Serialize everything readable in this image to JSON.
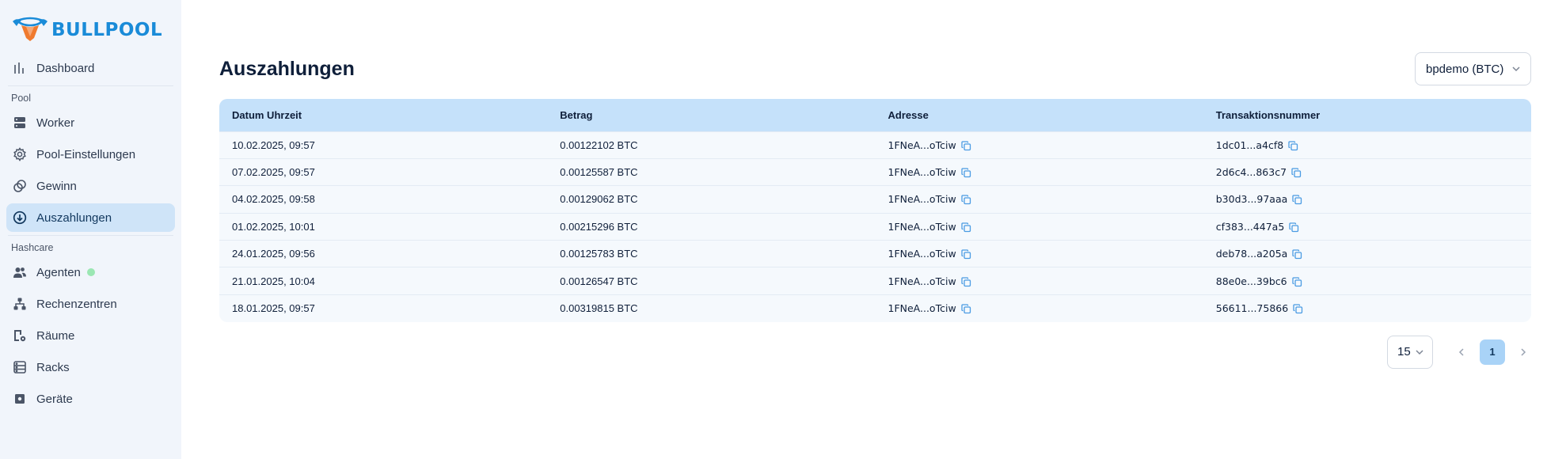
{
  "brand": {
    "name": "BULLPOOL"
  },
  "sidebar": {
    "top_items": [
      {
        "label": "Dashboard",
        "icon": "bar-chart-icon"
      }
    ],
    "sections": [
      {
        "label": "Pool",
        "items": [
          {
            "label": "Worker",
            "icon": "server-icon"
          },
          {
            "label": "Pool-Einstellungen",
            "icon": "gear-icon"
          },
          {
            "label": "Gewinn",
            "icon": "coins-icon"
          },
          {
            "label": "Auszahlungen",
            "icon": "download-circle-icon",
            "active": true
          }
        ]
      },
      {
        "label": "Hashcare",
        "items": [
          {
            "label": "Agenten",
            "icon": "users-icon",
            "status": "online"
          },
          {
            "label": "Rechenzentren",
            "icon": "hierarchy-icon"
          },
          {
            "label": "Räume",
            "icon": "room-icon"
          },
          {
            "label": "Racks",
            "icon": "rack-icon"
          },
          {
            "label": "Geräte",
            "icon": "chip-icon"
          }
        ]
      }
    ]
  },
  "page": {
    "title": "Auszahlungen",
    "account_select": "bpdemo (BTC)"
  },
  "table": {
    "columns": [
      "Datum Uhrzeit",
      "Betrag",
      "Adresse",
      "Transaktionsnummer"
    ],
    "rows": [
      [
        "10.02.2025, 09:57",
        "0.00122102 BTC",
        "1FNeA...oTciw",
        "1dc01...a4cf8"
      ],
      [
        "07.02.2025, 09:57",
        "0.00125587 BTC",
        "1FNeA...oTciw",
        "2d6c4...863c7"
      ],
      [
        "04.02.2025, 09:58",
        "0.00129062 BTC",
        "1FNeA...oTciw",
        "b30d3...97aaa"
      ],
      [
        "01.02.2025, 10:01",
        "0.00215296 BTC",
        "1FNeA...oTciw",
        "cf383...447a5"
      ],
      [
        "24.01.2025, 09:56",
        "0.00125783 BTC",
        "1FNeA...oTciw",
        "deb78...a205a"
      ],
      [
        "21.01.2025, 10:04",
        "0.00126547 BTC",
        "1FNeA...oTciw",
        "88e0e...39bc6"
      ],
      [
        "18.01.2025, 09:57",
        "0.00319815 BTC",
        "1FNeA...oTciw",
        "56611...75866"
      ]
    ]
  },
  "pagination": {
    "page_size": "15",
    "current_page": "1"
  },
  "colors": {
    "accent": "#1a8bd8",
    "active_bg": "#cfe4f8",
    "header_bg": "#c5e1fa",
    "status_online": "#9be7b3"
  }
}
